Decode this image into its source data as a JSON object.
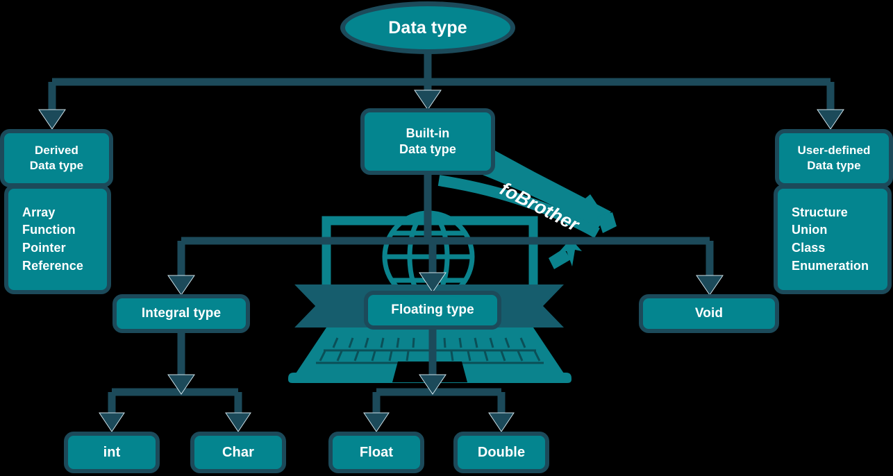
{
  "diagram": {
    "title": "Data type",
    "root": {
      "label": "Data type"
    },
    "level1": [
      {
        "id": "derived",
        "line1": "Derived",
        "line2": "Data type"
      },
      {
        "id": "builtin",
        "line1": "Built-in",
        "line2": "Data type"
      },
      {
        "id": "userdef",
        "line1": "User-defined",
        "line2": "Data type"
      }
    ],
    "derived_members": [
      "Array",
      "Function",
      "Pointer",
      "Reference"
    ],
    "userdefined_members": [
      "Structure",
      "Union",
      "Class",
      "Enumeration"
    ],
    "level2": [
      {
        "id": "integral",
        "label": "Integral type"
      },
      {
        "id": "floating",
        "label": "Floating type"
      },
      {
        "id": "void",
        "label": "Void"
      }
    ],
    "integral_children": [
      {
        "id": "int",
        "label": "int"
      },
      {
        "id": "char",
        "label": "Char"
      }
    ],
    "floating_children": [
      {
        "id": "float",
        "label": "Float"
      },
      {
        "id": "double",
        "label": "Double"
      }
    ],
    "watermark": {
      "brand": "foBrother"
    },
    "colors": {
      "background": "#000000",
      "node_fill": "#04858f",
      "node_border": "#1c4a5a",
      "connector": "#1c4a5a",
      "text": "#ffffff",
      "artwork_teal": "#0b838d",
      "artwork_ribbon": "#165d6d"
    }
  }
}
